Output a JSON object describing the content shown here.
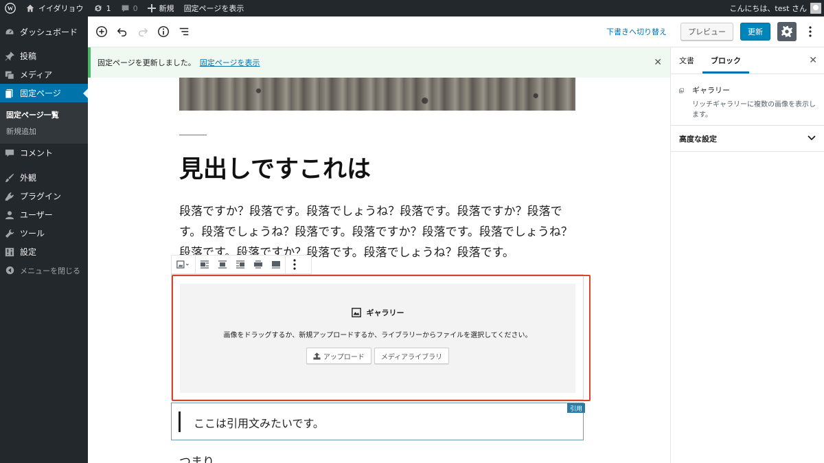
{
  "adminbar": {
    "site_name": "イイダリョウ",
    "updates_count": "1",
    "comments_count": "0",
    "new_label": "新規",
    "view_page_label": "固定ページを表示",
    "greeting": "こんにちは、test さん"
  },
  "sidebar": {
    "items": [
      {
        "label": "ダッシュボード",
        "icon": "dashboard-icon"
      },
      {
        "label": "投稿",
        "icon": "pin-icon"
      },
      {
        "label": "メディア",
        "icon": "media-icon"
      },
      {
        "label": "固定ページ",
        "icon": "page-icon"
      },
      {
        "label": "コメント",
        "icon": "comment-icon"
      },
      {
        "label": "外観",
        "icon": "brush-icon"
      },
      {
        "label": "プラグイン",
        "icon": "plugin-icon"
      },
      {
        "label": "ユーザー",
        "icon": "user-icon"
      },
      {
        "label": "ツール",
        "icon": "wrench-icon"
      },
      {
        "label": "設定",
        "icon": "settings-icon"
      }
    ],
    "submenu": [
      "固定ページ一覧",
      "新規追加"
    ],
    "collapse_label": "メニューを閉じる"
  },
  "header": {
    "switch_draft": "下書きへ切り替え",
    "preview": "プレビュー",
    "update": "更新"
  },
  "notice": {
    "message": "固定ページを更新しました。",
    "link": "固定ページを表示"
  },
  "content": {
    "heading": "見出しですこれは",
    "paragraph": "段落ですか？段落です。段落でしょうね？段落です。段落ですか？段落です。段落でしょうね？段落です。段落ですか？段落です。段落でしょうね？段落です。段落ですか？段落です。段落でしょうね？段落です。",
    "gallery": {
      "title": "ギャラリー",
      "instructions": "画像をドラッグするか、新規アップロードするか、ライブラリーからファイルを選択してください。",
      "upload_label": "アップロード",
      "library_label": "メディアライブラリ"
    },
    "quote_text": "ここは引用文みたいです。",
    "quote_tag": "引用",
    "paragraph2": "つまり"
  },
  "panel": {
    "tab_document": "文書",
    "tab_block": "ブロック",
    "block_name": "ギャラリー",
    "block_desc": "リッチギャラリーに複数の画像を表示します。",
    "advanced_label": "高度な設定"
  },
  "colors": {
    "admin_dark": "#23282d",
    "accent": "#0073aa",
    "selection_outline": "#d9422b",
    "notice_green": "#4ab866"
  }
}
